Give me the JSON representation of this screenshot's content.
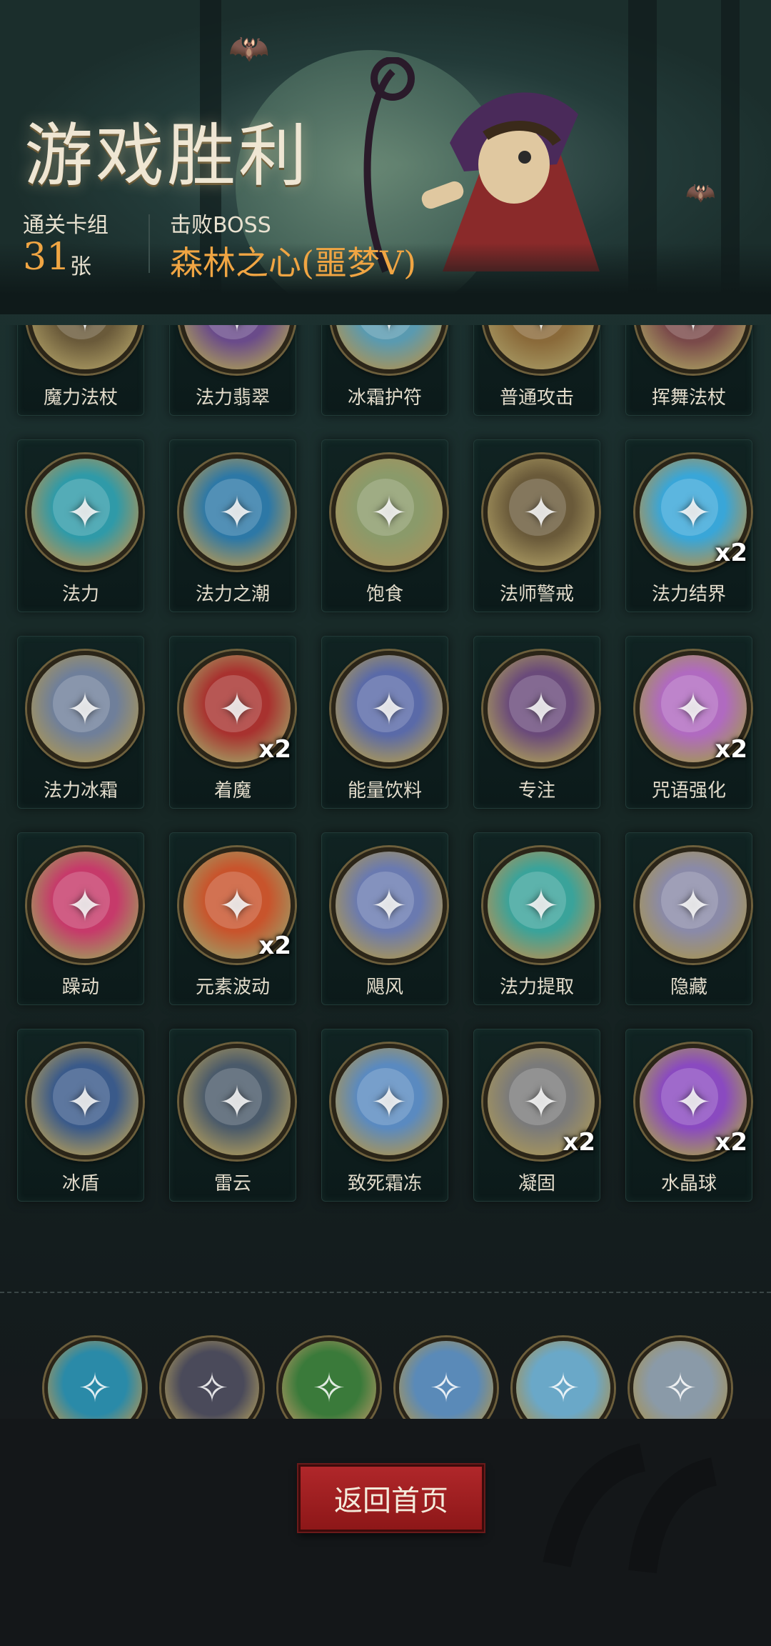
{
  "header": {
    "title": "游戏胜利",
    "deck_label": "通关卡组",
    "deck_count": "31",
    "deck_unit": "张",
    "boss_label": "击败BOSS",
    "boss_name": "森林之心(噩梦V)"
  },
  "cards": [
    {
      "name": "魔力法杖",
      "icon": "staff-icon",
      "color": "#6a5a3a",
      "badge": ""
    },
    {
      "name": "法力翡翠",
      "icon": "gem-icon",
      "color": "#6a4b8a",
      "badge": ""
    },
    {
      "name": "冰霜护符",
      "icon": "frost-charm-icon",
      "color": "#5a9ab0",
      "badge": ""
    },
    {
      "name": "普通攻击",
      "icon": "sword-icon",
      "color": "#8a6a3a",
      "badge": ""
    },
    {
      "name": "挥舞法杖",
      "icon": "wave-staff-icon",
      "color": "#7a4a4a",
      "badge": ""
    },
    {
      "name": "法力",
      "icon": "mana-orb-icon",
      "color": "#2f9aa8",
      "badge": ""
    },
    {
      "name": "法力之潮",
      "icon": "tide-icon",
      "color": "#2d78a6",
      "badge": ""
    },
    {
      "name": "饱食",
      "icon": "full-belly-icon",
      "color": "#8a9a6a",
      "badge": ""
    },
    {
      "name": "法师警戒",
      "icon": "hooded-mage-icon",
      "color": "#6a5a3a",
      "badge": ""
    },
    {
      "name": "法力结界",
      "icon": "barrier-icon",
      "color": "#39a6d8",
      "badge": "x2"
    },
    {
      "name": "法力冰霜",
      "icon": "ice-skull-icon",
      "color": "#6f7f9a",
      "badge": ""
    },
    {
      "name": "着魔",
      "icon": "possessed-icon",
      "color": "#a8322f",
      "badge": "x2"
    },
    {
      "name": "能量饮料",
      "icon": "potion-icon",
      "color": "#5a6aa8",
      "badge": ""
    },
    {
      "name": "专注",
      "icon": "focus-wizard-icon",
      "color": "#6a4a7a",
      "badge": ""
    },
    {
      "name": "咒语强化",
      "icon": "crystal-icon",
      "color": "#b06ac0",
      "badge": "x2"
    },
    {
      "name": "躁动",
      "icon": "frenzy-icon",
      "color": "#c63a6a",
      "badge": ""
    },
    {
      "name": "元素波动",
      "icon": "fire-wave-icon",
      "color": "#c8542c",
      "badge": "x2"
    },
    {
      "name": "飓风",
      "icon": "tornado-icon",
      "color": "#6a7ab0",
      "badge": ""
    },
    {
      "name": "法力提取",
      "icon": "skull-icon",
      "color": "#3aa39a",
      "badge": ""
    },
    {
      "name": "隐藏",
      "icon": "door-goblin-icon",
      "color": "#8a8aa8",
      "badge": ""
    },
    {
      "name": "冰盾",
      "icon": "ice-shield-icon",
      "color": "#3a5a8a",
      "badge": ""
    },
    {
      "name": "雷云",
      "icon": "storm-cloud-icon",
      "color": "#4a5a6a",
      "badge": ""
    },
    {
      "name": "致死霜冻",
      "icon": "frozen-skeleton-icon",
      "color": "#5a8ac0",
      "badge": ""
    },
    {
      "name": "凝固",
      "icon": "troll-icon",
      "color": "#7a7a7a",
      "badge": "x2"
    },
    {
      "name": "水晶球",
      "icon": "crystal-ball-icon",
      "color": "#8a4ac0",
      "badge": "x2"
    }
  ],
  "relics": [
    {
      "icon": "orb-staff-relic-icon",
      "color": "#2a8aa8"
    },
    {
      "icon": "hooded-figure-relic-icon",
      "color": "#4a4a5a"
    },
    {
      "icon": "green-flame-relic-icon",
      "color": "#3a7a3a"
    },
    {
      "icon": "crossed-staves-relic-icon",
      "color": "#5a8ab8"
    },
    {
      "icon": "ice-crystal-relic-icon",
      "color": "#6aa8c8"
    },
    {
      "icon": "dagger-relic-icon",
      "color": "#8a9aa8"
    }
  ],
  "footer": {
    "return_label": "返回首页"
  }
}
